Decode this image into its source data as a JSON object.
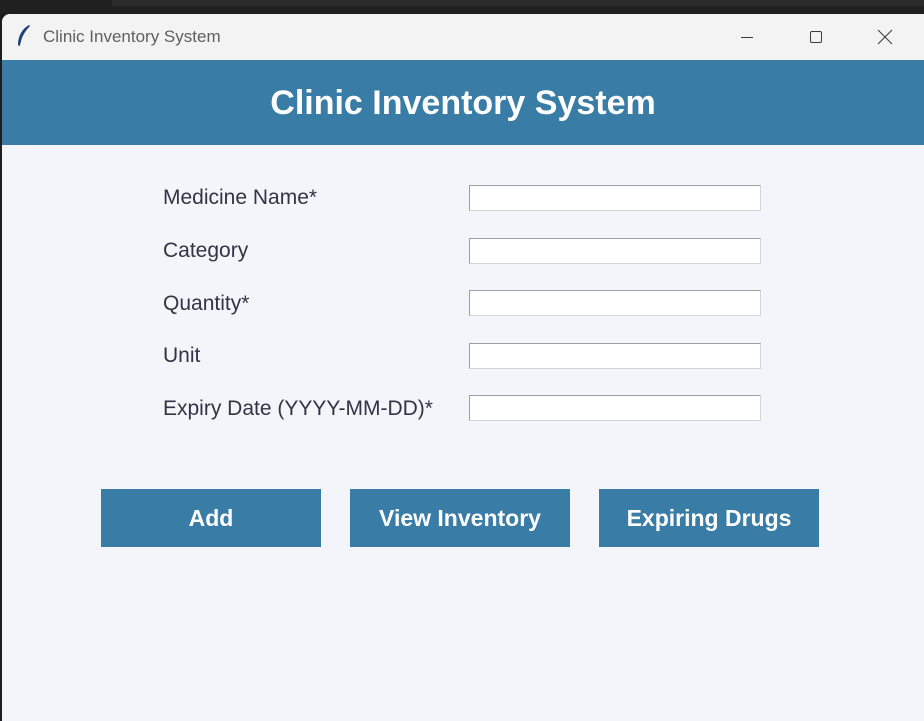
{
  "window": {
    "title": "Clinic Inventory System",
    "app_icon": "feather-icon",
    "controls": [
      "minimize-icon",
      "maximize-icon",
      "close-icon"
    ]
  },
  "header": {
    "title": "Clinic Inventory System"
  },
  "form": {
    "fields": [
      {
        "label": "Medicine Name*",
        "value": ""
      },
      {
        "label": "Category",
        "value": ""
      },
      {
        "label": "Quantity*",
        "value": ""
      },
      {
        "label": "Unit",
        "value": ""
      },
      {
        "label": "Expiry Date (YYYY-MM-DD)*",
        "value": ""
      }
    ]
  },
  "actions": {
    "add_label": "Add",
    "view_label": "View Inventory",
    "expiring_label": "Expiring Drugs"
  },
  "colors": {
    "accent": "#397ca6",
    "background": "#f4f5fa",
    "titlebar": "#f3f3f3"
  }
}
